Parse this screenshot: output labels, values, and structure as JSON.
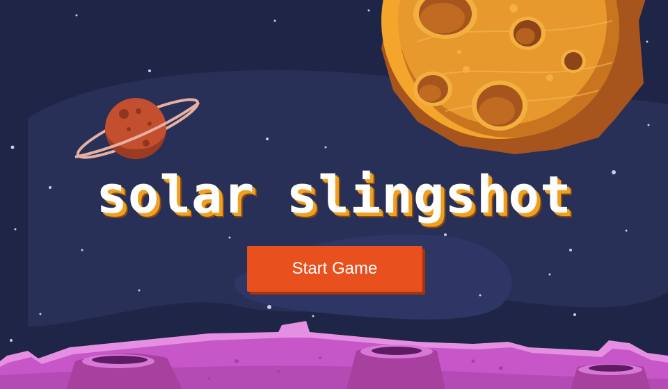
{
  "game": {
    "title": "solar slingshot",
    "start_button_label": "Start Game"
  },
  "colors": {
    "sky": "#1f2546",
    "nebula": "#283058",
    "planet_orange": "#e89a2a",
    "planet_red": "#c34f2f",
    "ground_purple": "#c757c8",
    "button": "#e8501e",
    "title_shadow": "#f0a020"
  }
}
